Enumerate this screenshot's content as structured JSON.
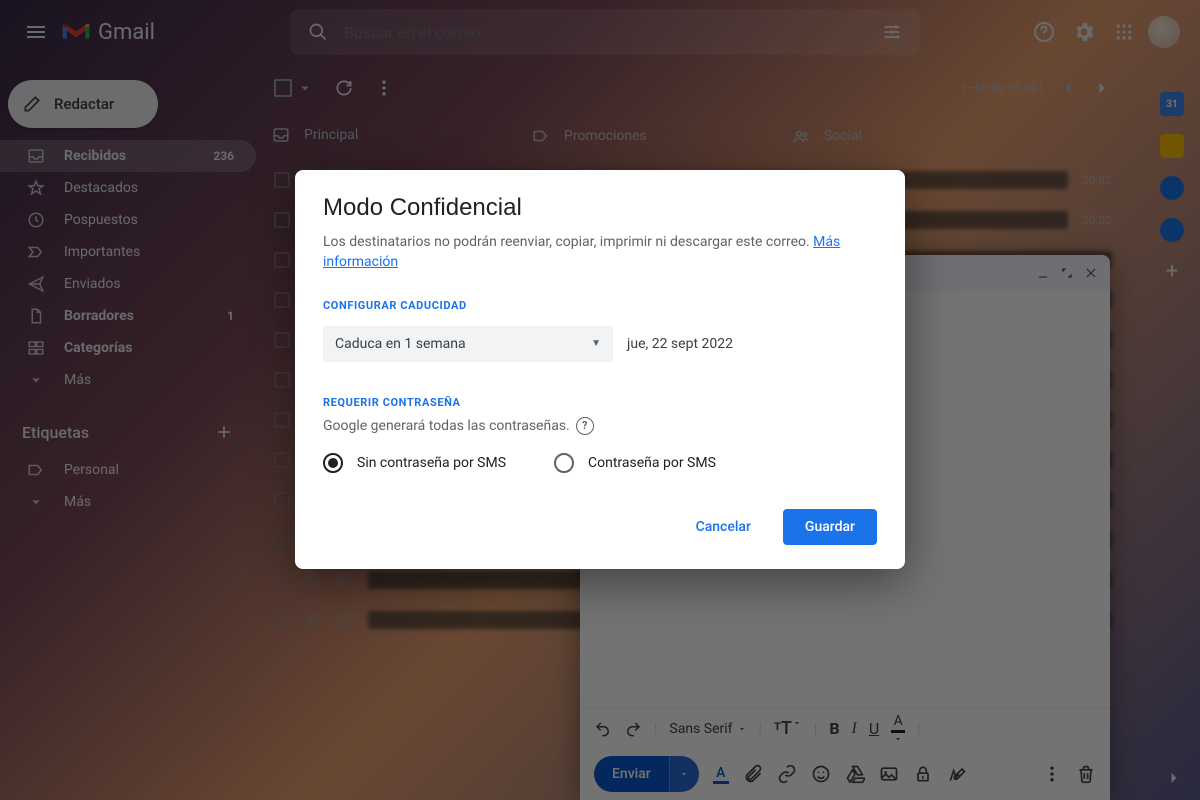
{
  "header": {
    "app_name": "Gmail",
    "search_placeholder": "Buscar en el correo"
  },
  "sidebar": {
    "compose_label": "Redactar",
    "folders": [
      {
        "label": "Recibidos",
        "count": "236",
        "bold": true,
        "active": true,
        "icon": "inbox-icon"
      },
      {
        "label": "Destacados",
        "count": "",
        "bold": false,
        "active": false,
        "icon": "star-icon"
      },
      {
        "label": "Pospuestos",
        "count": "",
        "bold": false,
        "active": false,
        "icon": "clock-icon"
      },
      {
        "label": "Importantes",
        "count": "",
        "bold": false,
        "active": false,
        "icon": "important-icon"
      },
      {
        "label": "Enviados",
        "count": "",
        "bold": false,
        "active": false,
        "icon": "send-icon"
      },
      {
        "label": "Borradores",
        "count": "1",
        "bold": true,
        "active": false,
        "icon": "draft-icon"
      },
      {
        "label": "Categorías",
        "count": "",
        "bold": true,
        "active": false,
        "icon": "categories-icon"
      },
      {
        "label": "Más",
        "count": "",
        "bold": false,
        "active": false,
        "icon": "chevron-down-icon"
      }
    ],
    "labels_heading": "Etiquetas",
    "labels": [
      {
        "label": "Personal",
        "icon": "tag-icon"
      },
      {
        "label": "Más",
        "icon": "chevron-down-icon"
      }
    ]
  },
  "toolbar": {
    "pager_text": "1–50 de 12.031"
  },
  "tabs": [
    {
      "label": "Principal",
      "icon": "inbox-icon"
    },
    {
      "label": "Promociones",
      "icon": "tag-icon"
    },
    {
      "label": "Social",
      "icon": "people-icon"
    }
  ],
  "sample_time": "20:02",
  "compose_card": {
    "font_family": "Sans Serif",
    "send_label": "Enviar"
  },
  "modal": {
    "title": "Modo Confidencial",
    "description": "Los destinatarios no podrán reenviar, copiar, imprimir ni descargar este correo. ",
    "learn_more": "Más información",
    "section_expiry": "CONFIGURAR CADUCIDAD",
    "expiry_select": "Caduca en 1 semana",
    "expiry_date": "jue, 22 sept 2022",
    "section_password": "REQUERIR CONTRASEÑA",
    "password_note": "Google generará todas las contraseñas.",
    "radio_no_sms": "Sin contraseña por SMS",
    "radio_sms": "Contraseña por SMS",
    "cancel": "Cancelar",
    "save": "Guardar"
  }
}
